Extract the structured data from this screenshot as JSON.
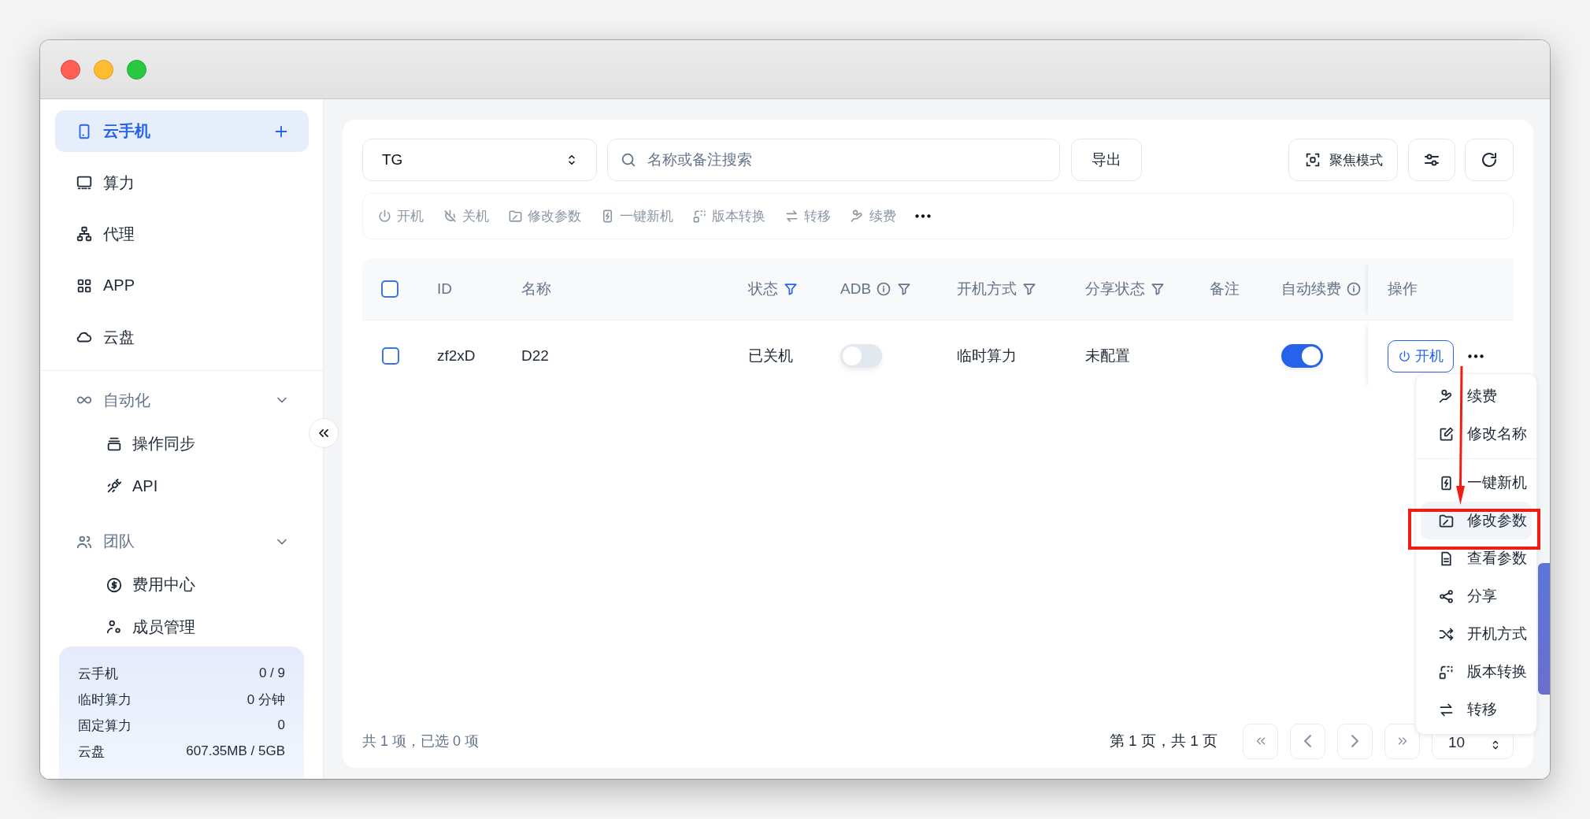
{
  "sidebar": {
    "nav": [
      {
        "label": "云手机",
        "selected": true
      },
      {
        "label": "算力",
        "selected": false
      },
      {
        "label": "代理",
        "selected": false
      },
      {
        "label": "APP",
        "selected": false
      },
      {
        "label": "云盘",
        "selected": false
      }
    ],
    "groups": [
      {
        "label": "自动化",
        "expanded": true,
        "children": [
          {
            "label": "操作同步"
          },
          {
            "label": "API"
          }
        ]
      },
      {
        "label": "团队",
        "expanded": true,
        "children": [
          {
            "label": "费用中心"
          },
          {
            "label": "成员管理"
          }
        ]
      }
    ],
    "quota": [
      {
        "label": "云手机",
        "value": "0 / 9"
      },
      {
        "label": "临时算力",
        "value": "0 分钟"
      },
      {
        "label": "固定算力",
        "value": "0"
      },
      {
        "label": "云盘",
        "value": "607.35MB / 5GB"
      }
    ]
  },
  "toolbar": {
    "group_select": "TG",
    "search": {
      "placeholder": "名称或备注搜索"
    },
    "export": "导出",
    "focus_mode": "聚焦模式"
  },
  "actions": [
    {
      "label": "开机",
      "disabled": true
    },
    {
      "label": "关机",
      "disabled": true
    },
    {
      "label": "修改参数",
      "disabled": true
    },
    {
      "label": "一键新机",
      "disabled": true
    },
    {
      "label": "版本转换",
      "disabled": true
    },
    {
      "label": "转移",
      "disabled": true
    },
    {
      "label": "续费",
      "disabled": true
    }
  ],
  "table": {
    "select_all": false,
    "columns": [
      {
        "label": "ID",
        "filter": false,
        "filtered": false,
        "info": false
      },
      {
        "label": "名称",
        "filter": false,
        "filtered": false,
        "info": false
      },
      {
        "label": "状态",
        "filter": true,
        "filtered": true,
        "info": false
      },
      {
        "label": "ADB",
        "filter": true,
        "filtered": false,
        "info": true
      },
      {
        "label": "开机方式",
        "filter": true,
        "filtered": false,
        "info": false
      },
      {
        "label": "分享状态",
        "filter": true,
        "filtered": false,
        "info": false
      },
      {
        "label": "备注",
        "filter": false,
        "filtered": false,
        "info": false
      },
      {
        "label": "自动续费",
        "filter": false,
        "filtered": false,
        "info": true
      },
      {
        "label": "操作",
        "filter": false,
        "filtered": false,
        "info": false
      }
    ],
    "rows": [
      {
        "selected": false,
        "id": "zf2xD",
        "name": "D22",
        "status": "已关机",
        "adb": false,
        "boot_mode": "临时算力",
        "share_status": "未配置",
        "auto_renew": true,
        "action": "开机"
      }
    ]
  },
  "footer": {
    "summary": "共 1 项，已选 0 项",
    "page_info": "第 1 页，共 1 页",
    "page_size": "10"
  },
  "menu": {
    "sections": [
      [
        {
          "label": "续费",
          "highlighted": false
        },
        {
          "label": "修改名称",
          "highlighted": false
        }
      ],
      [
        {
          "label": "一键新机",
          "highlighted": false
        },
        {
          "label": "修改参数",
          "highlighted": true
        },
        {
          "label": "查看参数",
          "highlighted": false
        },
        {
          "label": "分享",
          "highlighted": false
        },
        {
          "label": "开机方式",
          "highlighted": false
        },
        {
          "label": "版本转换",
          "highlighted": false
        },
        {
          "label": "转移",
          "highlighted": false
        }
      ]
    ]
  },
  "annotations": {
    "arrow": true,
    "highlight_box": true
  }
}
